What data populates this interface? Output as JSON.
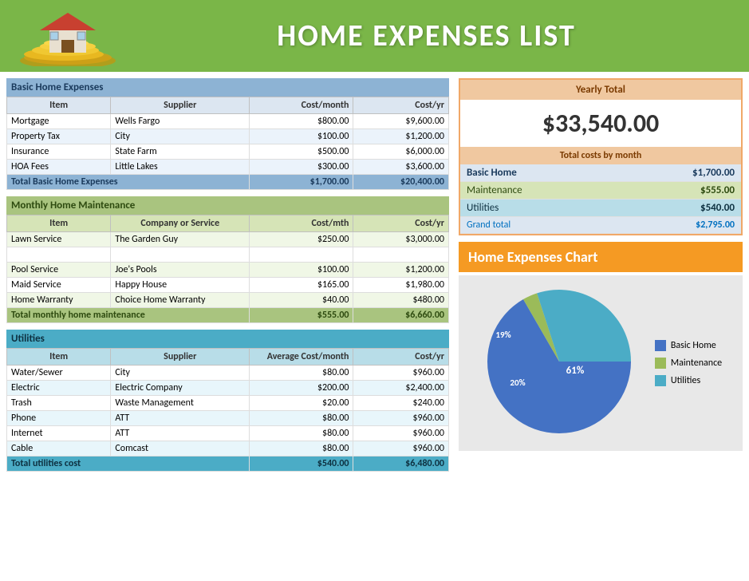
{
  "header": {
    "title": "HOME EXPENSES LIST"
  },
  "basic_home": {
    "section_title": "Basic Home Expenses",
    "columns": [
      "Item",
      "Supplier",
      "Cost/month",
      "Cost/yr"
    ],
    "rows": [
      [
        "Mortgage",
        "Wells Fargo",
        "$800.00",
        "$9,600.00"
      ],
      [
        "Property Tax",
        "City",
        "$100.00",
        "$1,200.00"
      ],
      [
        "Insurance",
        "State Farm",
        "$500.00",
        "$6,000.00"
      ],
      [
        "HOA Fees",
        "Little Lakes",
        "$300.00",
        "$3,600.00"
      ]
    ],
    "total_label": "Total Basic Home Expenses",
    "total_month": "$1,700.00",
    "total_year": "$20,400.00"
  },
  "maintenance": {
    "section_title": "Monthly Home Maintenance",
    "columns": [
      "Item",
      "Company or Service",
      "Cost/mth",
      "Cost/yr"
    ],
    "rows": [
      [
        "Lawn Service",
        "The Garden Guy",
        "$250.00",
        "$3,000.00"
      ],
      [
        "",
        "",
        "",
        ""
      ],
      [
        "Pool Service",
        "Joe's Pools",
        "$100.00",
        "$1,200.00"
      ],
      [
        "Maid Service",
        "Happy House",
        "$165.00",
        "$1,980.00"
      ],
      [
        "Home Warranty",
        "Choice Home Warranty",
        "$40.00",
        "$480.00"
      ]
    ],
    "total_label": "Total monthly home maintenance",
    "total_month": "$555.00",
    "total_year": "$6,660.00"
  },
  "utilities": {
    "section_title": "Utilities",
    "columns": [
      "Item",
      "Supplier",
      "Average Cost/month",
      "Cost/yr"
    ],
    "rows": [
      [
        "Water/Sewer",
        "City",
        "$80.00",
        "$960.00"
      ],
      [
        "Electric",
        "Electric Company",
        "$200.00",
        "$2,400.00"
      ],
      [
        "Trash",
        "Waste Management",
        "$20.00",
        "$240.00"
      ],
      [
        "Phone",
        "ATT",
        "$80.00",
        "$960.00"
      ],
      [
        "Internet",
        "ATT",
        "$80.00",
        "$960.00"
      ],
      [
        "Cable",
        "Comcast",
        "$80.00",
        "$960.00"
      ]
    ],
    "total_label": "Total utilities cost",
    "total_month": "$540.00",
    "total_year": "$6,480.00"
  },
  "yearly": {
    "title": "Yearly Total",
    "amount": "$33,540.00",
    "monthly_title": "Total costs by month",
    "rows": [
      {
        "label": "Basic Home",
        "value": "$1,700.00"
      },
      {
        "label": "Maintenance",
        "value": "$555.00"
      },
      {
        "label": "Utilities",
        "value": "$540.00"
      }
    ],
    "grand_label": "Grand total",
    "grand_value": "$2,795.00"
  },
  "chart": {
    "title": "Home Expenses Chart",
    "segments": [
      {
        "label": "Basic Home",
        "pct": 61,
        "color": "#4472c4"
      },
      {
        "label": "Maintenance",
        "pct": 19,
        "color": "#9bbb59"
      },
      {
        "label": "Utilities",
        "pct": 20,
        "color": "#4bacc6"
      }
    ]
  }
}
